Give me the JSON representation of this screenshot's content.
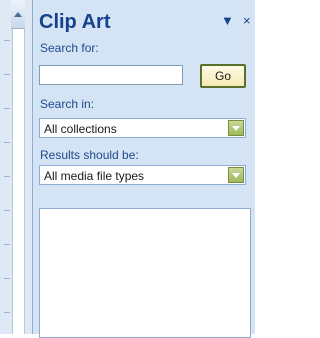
{
  "pane": {
    "title": "Clip Art",
    "menu_icon": "dropdown-triangle-icon",
    "close_glyph": "×"
  },
  "search": {
    "label": "Search for:",
    "value": "",
    "go_label": "Go"
  },
  "search_in": {
    "label": "Search in:",
    "selected": "All collections"
  },
  "results_type": {
    "label": "Results should be:",
    "selected": "All media file types"
  },
  "colors": {
    "pane_background": "#d5e4f5",
    "title_color": "#15428b",
    "label_color": "#1e4a8c",
    "dropdown_button": "#9eb85a"
  }
}
